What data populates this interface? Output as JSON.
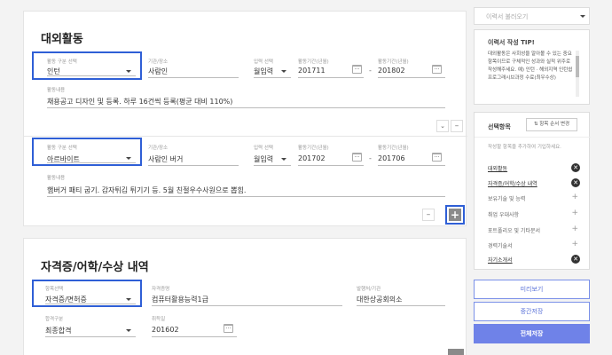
{
  "sec1": {
    "title": "대외활동",
    "entries": [
      {
        "type_label": "활동 구분 선택",
        "type": "인턴",
        "org_label": "기관/장소",
        "org": "사람인",
        "status_label": "입력 선택",
        "status": "월입력",
        "start_label": "활동기간(년월)",
        "start": "201711",
        "end_label": "활동기간(년월)",
        "end": "201802",
        "desc_label": "활동내용",
        "desc": "채용공고 디자인 및 등록. 하루 16건씩 등록(평균 대비 110%)"
      },
      {
        "type_label": "활동 구분 선택",
        "type": "아르바이트",
        "org_label": "기관/장소",
        "org": "사람인 버거",
        "status_label": "입력 선택",
        "status": "월입력",
        "start_label": "활동기간(년월)",
        "start": "201702",
        "end_label": "활동기간(년월)",
        "end": "201706",
        "desc_label": "활동내용",
        "desc": "햄버거 패티 굽기. 감자튀김 튀기기 등. 5월 친절우수사원으로 뽑힘."
      }
    ],
    "dash": "-",
    "down_glyph": "⌄",
    "minus_glyph": "–",
    "plus_glyph": "+"
  },
  "sec2": {
    "title": "자격증/어학/수상 내역",
    "type_label": "항목선택",
    "type": "자격증/면허증",
    "name_label": "자격증명",
    "name": "컴퓨터활용능력1급",
    "issuer_label": "발행처/기관",
    "issuer": "대한상공회의소",
    "result_label": "합격구분",
    "result": "최종합격",
    "date_label": "취득일",
    "date": "201602"
  },
  "sidebar": {
    "load_label": "이력서 불러오기",
    "tip_title": "이력서 작성 TIP!",
    "tip_body": "대외활동은 사회성을 알아볼 수 있는 중요 항목이므로 구체적인 성과와 실적 위주로 작성해주세요. 예) 인턴 · 해외지역 인턴쉽 프로그래시브과정 수료(최우수상)",
    "items_title": "선택항목",
    "order_button": "⇅ 항목 순서 변경",
    "hint": "작성할 항목을 추가하여 기입하세요.",
    "items": [
      {
        "label": "대외활동",
        "icon": "✕"
      },
      {
        "label": "자격증/어학/수상 내역",
        "icon": "✕"
      },
      {
        "label": "보유기술 및 능력",
        "icon": "+"
      },
      {
        "label": "취업 우대사항",
        "icon": "+"
      },
      {
        "label": "포트폴리오 및 기타문서",
        "icon": "+"
      },
      {
        "label": "경력기술서",
        "icon": "+"
      },
      {
        "label": "자기소개서",
        "icon": "✕"
      }
    ],
    "preview": "미리보기",
    "temp_save": "중간저장",
    "save_all": "전체저장"
  }
}
